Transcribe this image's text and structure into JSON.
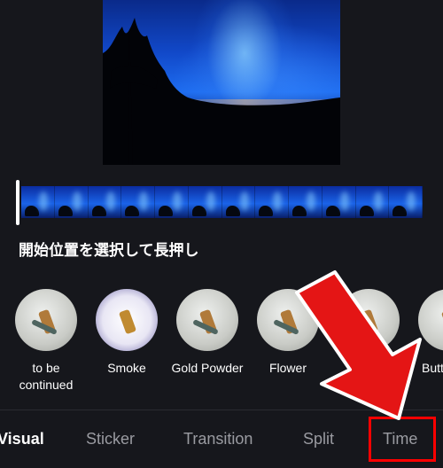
{
  "hint_text": "開始位置を選択して長押し",
  "effects": [
    {
      "label": "to be continued",
      "icon": "effect-thumb-to-be-continued"
    },
    {
      "label": "Smoke",
      "icon": "effect-thumb-smoke"
    },
    {
      "label": "Gold Powder",
      "icon": "effect-thumb-gold-powder"
    },
    {
      "label": "Flower",
      "icon": "effect-thumb-flower"
    },
    {
      "label": "",
      "icon": "effect-thumb-partial"
    },
    {
      "label": "Butt",
      "icon": "effect-thumb-butt"
    }
  ],
  "tabs": [
    {
      "label": "Visual",
      "active": true
    },
    {
      "label": "Sticker",
      "active": false
    },
    {
      "label": "Transition",
      "active": false
    },
    {
      "label": "Split",
      "active": false
    },
    {
      "label": "Time",
      "active": false
    }
  ],
  "colors": {
    "background": "#16171c",
    "annotation": "#ff0000",
    "active_tab": "#ffffff",
    "inactive_tab": "#9a9ba1"
  }
}
